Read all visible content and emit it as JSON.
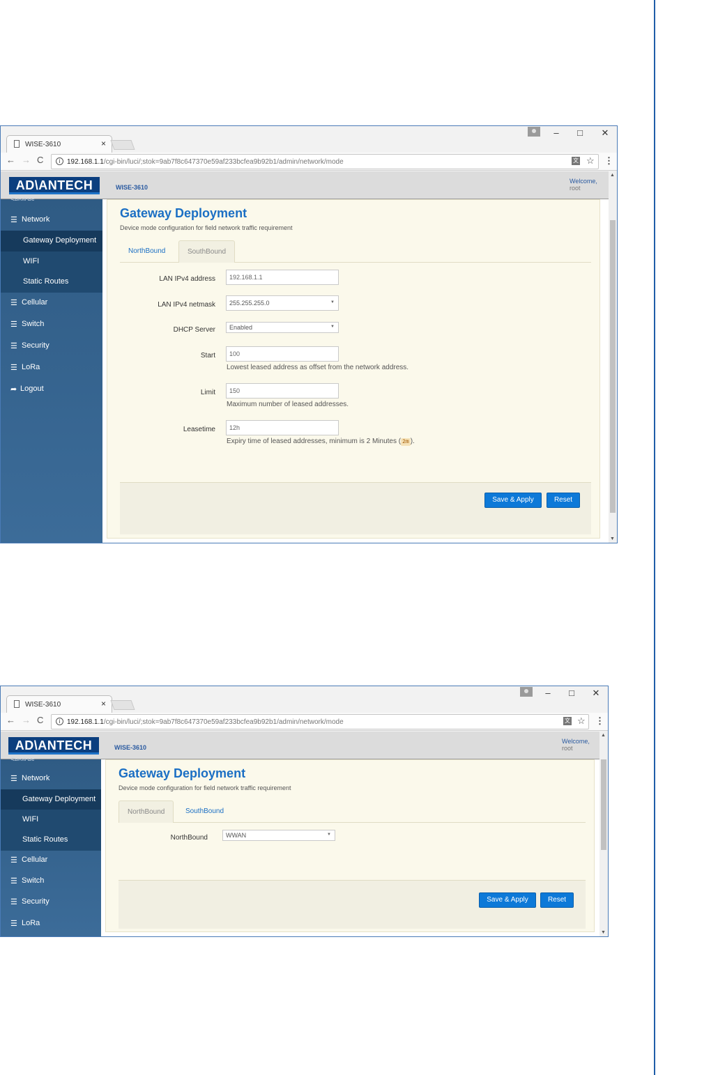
{
  "browser": {
    "tab_title": "WISE-3610",
    "tab_close": "×",
    "url_host": "192.168.1.1",
    "url_path": "/cgi-bin/luci/;stok=9ab7f8c647370e59af233bcfea9b92b1/admin/network/mode",
    "window_controls": {
      "minimize": "–",
      "maximize": "□",
      "close": "✕"
    },
    "nav": {
      "back": "←",
      "forward": "→",
      "reload": "C"
    },
    "info_glyph": "i",
    "star_glyph": "☆",
    "menu_glyph": "⋮",
    "translate_glyph": "文"
  },
  "header": {
    "logo": "AD\\ANTECH",
    "device_name": "WISE-3610",
    "welcome": "Welcome,",
    "user": "root"
  },
  "sidebar": {
    "cut_label": "Services",
    "items": [
      {
        "label": "Network",
        "icon": "list-icon"
      },
      {
        "label": "Gateway Deployment"
      },
      {
        "label": "WIFI"
      },
      {
        "label": "Static Routes"
      },
      {
        "label": "Cellular",
        "icon": "list-icon"
      },
      {
        "label": "Switch",
        "icon": "list-icon"
      },
      {
        "label": "Security",
        "icon": "list-icon"
      },
      {
        "label": "LoRa",
        "icon": "list-icon"
      },
      {
        "label": "Logout",
        "icon": "logout-icon"
      }
    ],
    "list_glyph": "☰",
    "logout_glyph": "➦"
  },
  "page": {
    "title": "Gateway Deployment",
    "description": "Device mode configuration for field network traffic requirement",
    "tabs": [
      "NorthBound",
      "SouthBound"
    ]
  },
  "southbound_form": {
    "lan_ipv4_address": {
      "label": "LAN IPv4 address",
      "value": "192.168.1.1"
    },
    "lan_ipv4_netmask": {
      "label": "LAN IPv4 netmask",
      "value": "255.255.255.0"
    },
    "dhcp_server": {
      "label": "DHCP Server",
      "value": "Enabled"
    },
    "start": {
      "label": "Start",
      "value": "100",
      "hint": "Lowest leased address as offset from the network address."
    },
    "limit": {
      "label": "Limit",
      "value": "150",
      "hint": "Maximum number of leased addresses."
    },
    "leasetime": {
      "label": "Leasetime",
      "value": "12h",
      "hint_before": "Expiry time of leased addresses, minimum is 2 Minutes (",
      "hint_code": "2m",
      "hint_after": ")."
    }
  },
  "northbound_form": {
    "northbound": {
      "label": "NorthBound",
      "value": "WWAN"
    }
  },
  "actions": {
    "save_apply": "Save & Apply",
    "reset": "Reset"
  },
  "colors": {
    "accent": "#1b6fc4",
    "sidebar": "#2f5b84",
    "button": "#0d79d8",
    "panel": "#fbf9eb",
    "rule": "#1f5da8"
  }
}
